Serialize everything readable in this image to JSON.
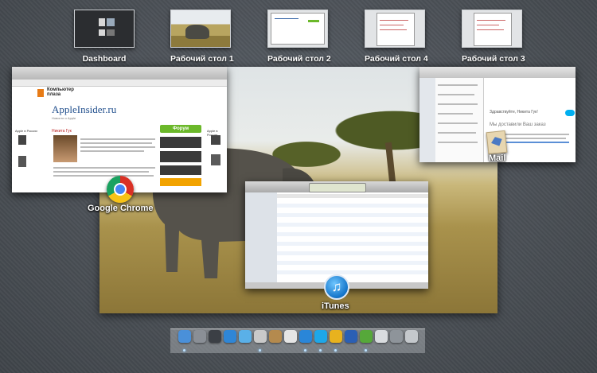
{
  "spaces": [
    {
      "label": "Dashboard",
      "thumb": "dashboard"
    },
    {
      "label": "Рабочий стол 1",
      "thumb": "savanna"
    },
    {
      "label": "Рабочий стол 2",
      "thumb": "browser"
    },
    {
      "label": "Рабочий стол 4",
      "thumb": "document"
    },
    {
      "label": "Рабочий стол 3",
      "thumb": "document"
    }
  ],
  "windows": {
    "chrome": {
      "app_label": "Google Chrome",
      "site_logo_text": "Компьютер плаза",
      "site_title": "AppleInsider.ru",
      "site_tagline": "Новости о Apple",
      "author": "Никита Гук",
      "forum_button": "Форум",
      "side_heading": "Apple в России"
    },
    "mail": {
      "app_label": "Mail",
      "greeting": "Здравствуйте, Никита Гук!",
      "heading": "Мы доставили Ваш заказ"
    },
    "itunes": {
      "app_label": "iTunes"
    }
  },
  "dock": {
    "icons": [
      {
        "name": "finder-icon",
        "color": "#4a90d9"
      },
      {
        "name": "launchpad-icon",
        "color": "#8a8f96"
      },
      {
        "name": "mission-control-icon",
        "color": "#3b3f45"
      },
      {
        "name": "app-store-icon",
        "color": "#2f86d6"
      },
      {
        "name": "safari-icon",
        "color": "#5ab0e8"
      },
      {
        "name": "mail-icon",
        "color": "#c9c9c9"
      },
      {
        "name": "contacts-icon",
        "color": "#b48a4e"
      },
      {
        "name": "calendar-icon",
        "color": "#e5e5e5"
      },
      {
        "name": "itunes-icon",
        "color": "#2a86d8"
      },
      {
        "name": "skype-icon",
        "color": "#1ea7e8"
      },
      {
        "name": "chrome-icon",
        "color": "#e8b21e"
      },
      {
        "name": "word-icon",
        "color": "#2b5fb4"
      },
      {
        "name": "utorrent-icon",
        "color": "#56a83a"
      },
      {
        "name": "documents-icon",
        "color": "#d9dcdf"
      },
      {
        "name": "downloads-icon",
        "color": "#8e949a"
      },
      {
        "name": "trash-icon",
        "color": "#c4c8cc"
      }
    ]
  }
}
